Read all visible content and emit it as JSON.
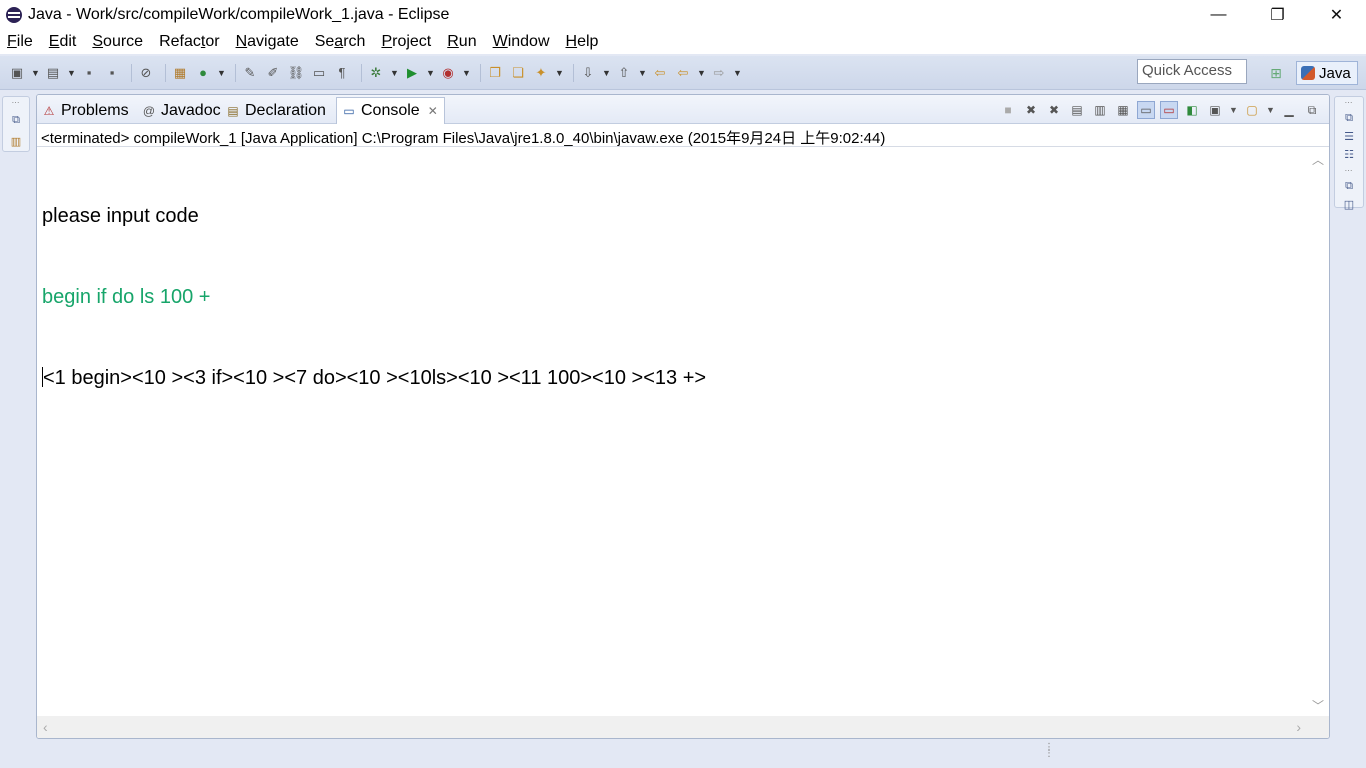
{
  "window": {
    "title": "Java - Work/src/compileWork/compileWork_1.java - Eclipse",
    "controls": {
      "minimize": "—",
      "maximize": "❐",
      "close": "✕"
    }
  },
  "menu": [
    {
      "mnemonic": "F",
      "rest": "ile"
    },
    {
      "mnemonic": "E",
      "rest": "dit"
    },
    {
      "mnemonic": "S",
      "rest": "ource"
    },
    {
      "pre": "Refac",
      "mnemonic": "t",
      "rest": "or"
    },
    {
      "mnemonic": "N",
      "rest": "avigate"
    },
    {
      "pre": "Se",
      "mnemonic": "a",
      "rest": "rch"
    },
    {
      "mnemonic": "P",
      "rest": "roject"
    },
    {
      "mnemonic": "R",
      "rest": "un"
    },
    {
      "mnemonic": "W",
      "rest": "indow"
    },
    {
      "mnemonic": "H",
      "rest": "elp"
    }
  ],
  "toolbar": {
    "quick_access": "Quick Access",
    "perspective": "Java"
  },
  "tabs": {
    "problems": "Problems",
    "javadoc": "Javadoc",
    "declaration": "Declaration",
    "console": "Console"
  },
  "console": {
    "header": "<terminated> compileWork_1 [Java Application] C:\\Program Files\\Java\\jre1.8.0_40\\bin\\javaw.exe (2015年9月24日 上午9:02:44)",
    "line1": "please input code",
    "line2": "begin if do ls 100 +",
    "line3": "<1 begin><10 ><3 if><10 ><7 do><10 ><10ls><10 ><11 100><10 ><13 +>"
  },
  "colors": {
    "stdin_text": "#17a56a",
    "stdout_text": "#000000",
    "workbench_bg": "#e3e8f4"
  }
}
